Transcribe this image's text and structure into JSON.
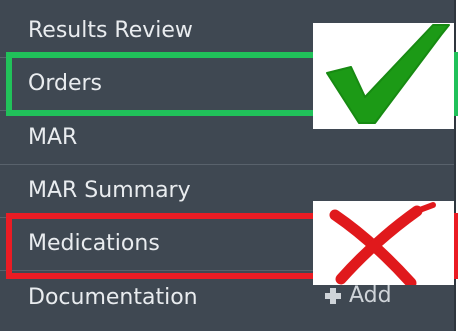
{
  "menu": {
    "items": [
      {
        "label": "Results Review"
      },
      {
        "label": "Orders"
      },
      {
        "label": "MAR"
      },
      {
        "label": "MAR Summary"
      },
      {
        "label": "Medications"
      },
      {
        "label": "Documentation",
        "action_label": "Add"
      }
    ]
  },
  "annotations": {
    "highlight_colors": {
      "correct": "#21c15a",
      "incorrect": "#ea1c24"
    },
    "correct_icon": "checkmark-icon",
    "incorrect_icon": "x-mark-icon"
  },
  "colors": {
    "panel_background": "#3f4852",
    "text": "#e9ecef"
  }
}
